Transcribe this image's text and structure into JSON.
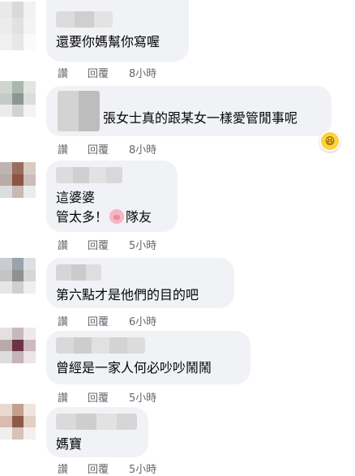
{
  "actions": {
    "read": "讚",
    "reply": "回覆"
  },
  "comments": [
    {
      "text": "還要你媽幫你寫喔",
      "time": "8小時"
    },
    {
      "text": "張女士真的跟某女一樣愛管閒事呢",
      "time": "8小時"
    },
    {
      "line1": "這婆婆",
      "line2a": "管太多！",
      "line2b": "隊友",
      "time": "5小時"
    },
    {
      "text": "第六點才是他們的目的吧",
      "time": "6小時"
    },
    {
      "text": "曾經是一家人何必吵吵鬧鬧",
      "time": "5小時"
    },
    {
      "text": "媽寶",
      "time": "5小時"
    }
  ],
  "colors": {
    "bubble": "#f0f2f5",
    "action_text": "#65676b",
    "body_text": "#050505"
  }
}
